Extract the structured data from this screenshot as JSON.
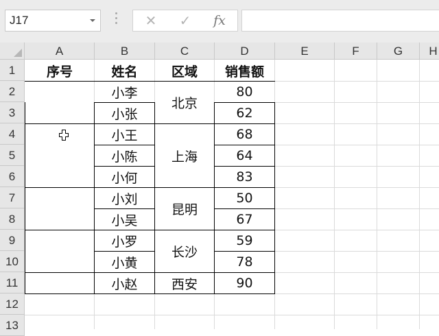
{
  "formula_bar": {
    "name_box": "J17",
    "cancel_icon": "✕",
    "enter_icon": "✓",
    "fx_label": "fx",
    "formula": ""
  },
  "columns": [
    "A",
    "B",
    "C",
    "D",
    "E",
    "F",
    "G",
    "H"
  ],
  "rows": [
    "1",
    "2",
    "3",
    "4",
    "5",
    "6",
    "7",
    "8",
    "9",
    "10",
    "11",
    "12",
    "13"
  ],
  "table": {
    "headers": {
      "seq": "序号",
      "name": "姓名",
      "region": "区域",
      "sales": "销售额"
    },
    "names": [
      "小李",
      "小张",
      "小王",
      "小陈",
      "小何",
      "小刘",
      "小吴",
      "小罗",
      "小黄",
      "小赵"
    ],
    "sales": [
      "80",
      "62",
      "68",
      "64",
      "83",
      "50",
      "67",
      "59",
      "78",
      "90"
    ],
    "regions": [
      "北京",
      "上海",
      "昆明",
      "长沙",
      "西安"
    ]
  },
  "colors": {
    "header_bg": "#e6e6e6",
    "gridline": "#dadada",
    "border": "#000000"
  },
  "icons": {
    "cursor": "plus-cursor-icon"
  }
}
